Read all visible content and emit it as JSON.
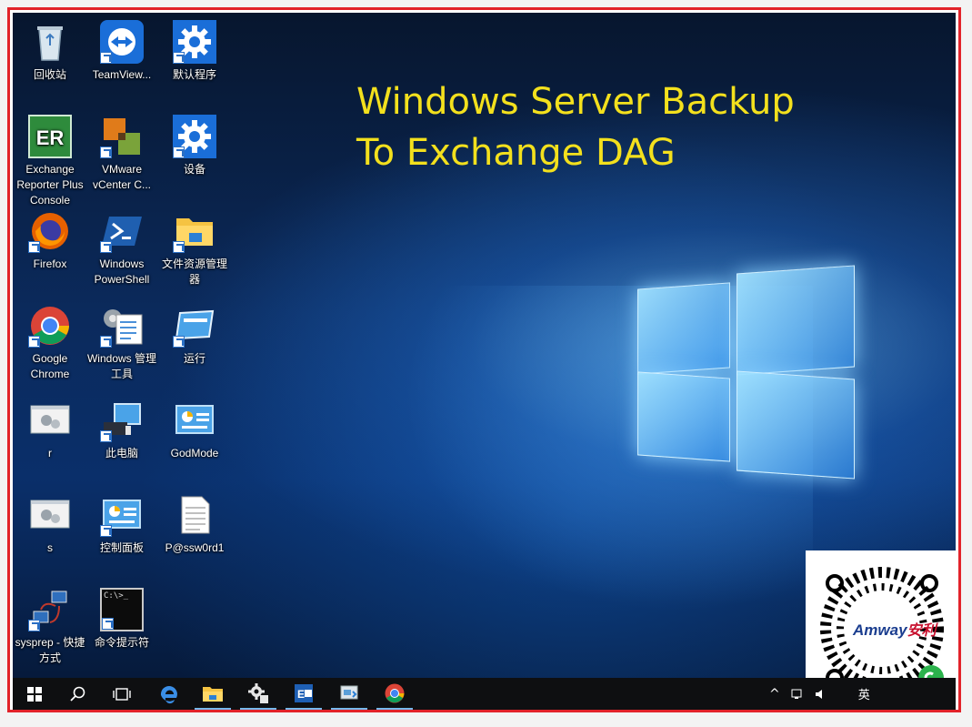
{
  "title": {
    "line1": "Windows Server Backup",
    "line2": "To Exchange DAG"
  },
  "desktop_icons": [
    {
      "label": "回收站",
      "icon": "recycle-bin-icon"
    },
    {
      "label": "TeamView...",
      "icon": "teamviewer-icon"
    },
    {
      "label": "默认程序",
      "icon": "gear-icon"
    },
    {
      "label": "Exchange Reporter Plus Console",
      "icon": "exchange-reporter-icon",
      "glyph_text": "ER"
    },
    {
      "label": "VMware vCenter C...",
      "icon": "vmware-icon"
    },
    {
      "label": "设备",
      "icon": "gear-icon"
    },
    {
      "label": "Firefox",
      "icon": "firefox-icon"
    },
    {
      "label": "Windows PowerShell",
      "icon": "powershell-icon"
    },
    {
      "label": "文件资源管理器",
      "icon": "folder-icon"
    },
    {
      "label": "Google Chrome",
      "icon": "chrome-icon"
    },
    {
      "label": "Windows 管理工具",
      "icon": "admin-tools-icon"
    },
    {
      "label": "运行",
      "icon": "run-icon"
    },
    {
      "label": "r",
      "icon": "batch-file-icon"
    },
    {
      "label": "此电脑",
      "icon": "computer-icon"
    },
    {
      "label": "GodMode",
      "icon": "control-panel-icon"
    },
    {
      "label": "s",
      "icon": "batch-file-icon"
    },
    {
      "label": "控制面板",
      "icon": "control-panel-icon"
    },
    {
      "label": "P@ssw0rd1",
      "icon": "text-file-icon"
    },
    {
      "label": "sysprep - 快捷方式",
      "icon": "network-computers-icon"
    },
    {
      "label": "命令提示符",
      "icon": "cmd-icon",
      "glyph_text": "C:\\>_"
    }
  ],
  "taskbar": {
    "items": [
      {
        "icon": "windows-start-icon"
      },
      {
        "icon": "search-icon"
      },
      {
        "icon": "task-view-icon"
      },
      {
        "icon": "edge-icon"
      },
      {
        "icon": "file-explorer-icon"
      },
      {
        "icon": "server-manager-icon"
      },
      {
        "icon": "exchange-shell-icon"
      },
      {
        "icon": "backup-icon"
      },
      {
        "icon": "chrome-icon"
      }
    ],
    "tray": {
      "ime": "英"
    }
  },
  "qr": {
    "brand": "Amway",
    "brand_cn": "安利"
  },
  "colors": {
    "title": "#f3e01d",
    "frame": "#e2232a",
    "taskbar": "#0e0f11"
  }
}
